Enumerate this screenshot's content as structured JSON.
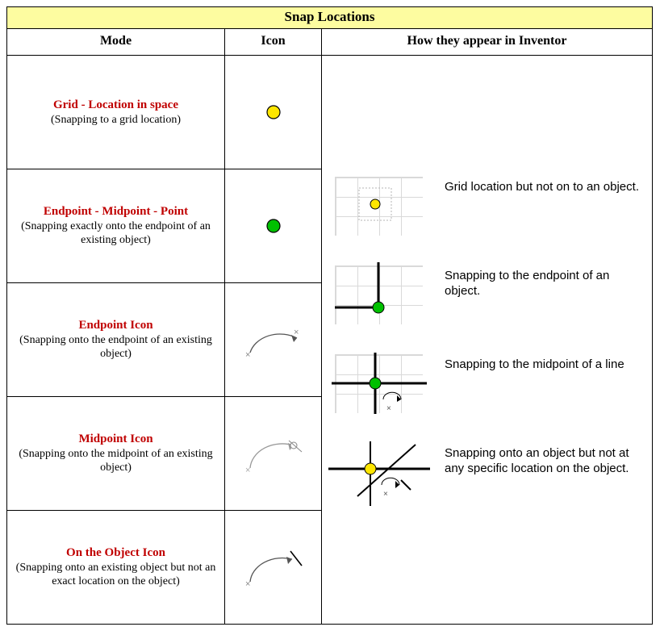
{
  "title": "Snap Locations",
  "headers": {
    "mode": "Mode",
    "icon": "Icon",
    "how": "How they appear in Inventor"
  },
  "rows": [
    {
      "title": "Grid - Location in space",
      "subtitle": "(Snapping to a grid location)",
      "icon": "grid-dot"
    },
    {
      "title": "Endpoint - Midpoint - Point",
      "subtitle": "(Snapping exactly onto the endpoint of an existing object)",
      "icon": "green-dot"
    },
    {
      "title": " Endpoint  Icon",
      "subtitle": "(Snapping onto the endpoint of an existing object)",
      "icon": "arc-endpoint"
    },
    {
      "title": " Midpoint  Icon",
      "subtitle": "(Snapping onto the midpoint of an existing object)",
      "icon": "arc-midpoint"
    },
    {
      "title": "On the Object Icon",
      "subtitle": "(Snapping onto an existing object but not an exact location on the object)",
      "icon": "arc-onobject"
    }
  ],
  "how": [
    {
      "desc": "Grid location but not on to an object.",
      "preview": "grid-point"
    },
    {
      "desc": "Snapping to the endpoint of an object.",
      "preview": "endpoint"
    },
    {
      "desc": "Snapping to the midpoint of a line",
      "preview": "midpoint"
    },
    {
      "desc": "Snapping onto an object but not at any specific location on the object.",
      "preview": "onobject"
    }
  ],
  "colors": {
    "title_bg": "#fdfca0",
    "mode_title": "#c00000",
    "grid_dot_fill": "#fee600",
    "green_dot_fill": "#00c000",
    "onobject_dot_fill": "#fee600"
  }
}
